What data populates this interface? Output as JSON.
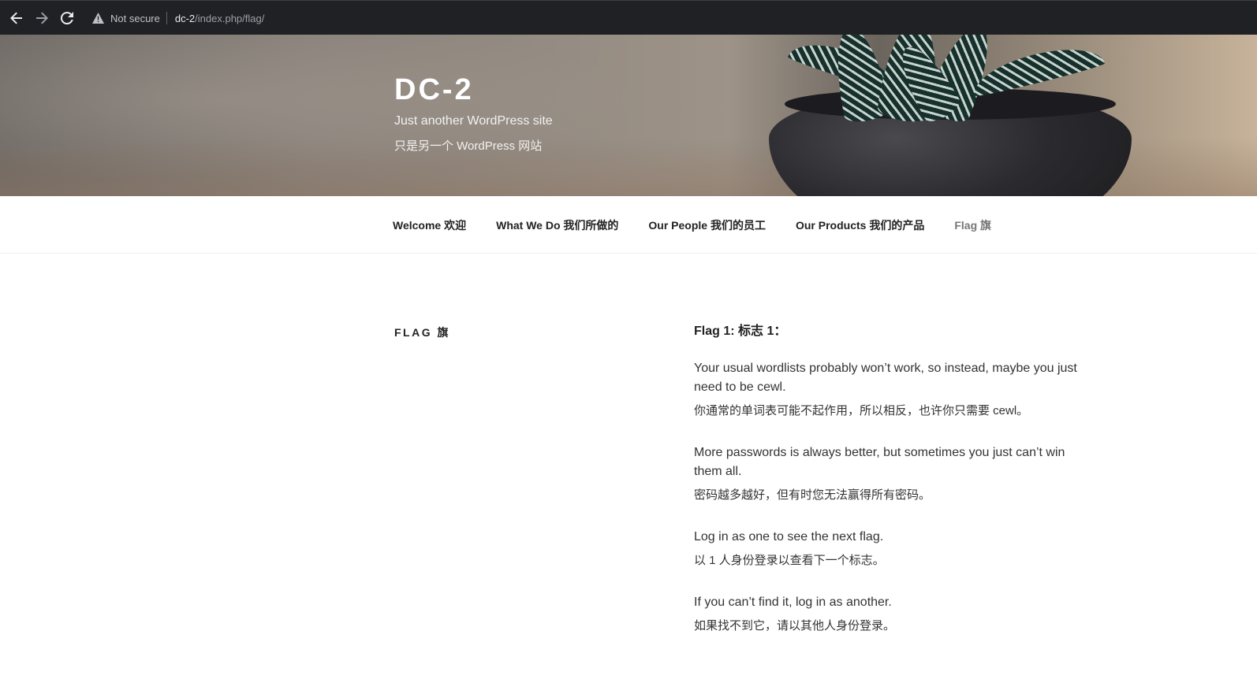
{
  "browser": {
    "security_label": "Not secure",
    "url_host": "dc-2",
    "url_path": "/index.php/flag/"
  },
  "site": {
    "title": "DC-2",
    "description_en": "Just another WordPress site",
    "description_zh": "只是另一个 WordPress 网站"
  },
  "menu": {
    "items": [
      {
        "label": "Welcome 欢迎"
      },
      {
        "label": "What We Do 我们所做的"
      },
      {
        "label": "Our People 我们的员工"
      },
      {
        "label": "Our Products 我们的产品"
      },
      {
        "label": "Flag 旗"
      }
    ]
  },
  "page": {
    "title": "FLAG 旗",
    "heading": "Flag 1: 标志 1：",
    "paragraphs": [
      {
        "en": "Your usual wordlists probably won’t work, so instead, maybe you just need to be cewl.",
        "zh": "你通常的单词表可能不起作用，所以相反，也许你只需要 cewl。"
      },
      {
        "en": "More passwords is always better, but sometimes you just can’t win them all.",
        "zh": "密码越多越好，但有时您无法赢得所有密码。"
      },
      {
        "en": "Log in as one to see the next flag.",
        "zh": "以 1 人身份登录以查看下一个标志。"
      },
      {
        "en": "If you can’t find it, log in as another.",
        "zh": "如果找不到它，请以其他人身份登录。"
      }
    ]
  },
  "colors": {
    "chrome_bg": "#202124",
    "menu_current": "#767676",
    "text": "#333333"
  }
}
